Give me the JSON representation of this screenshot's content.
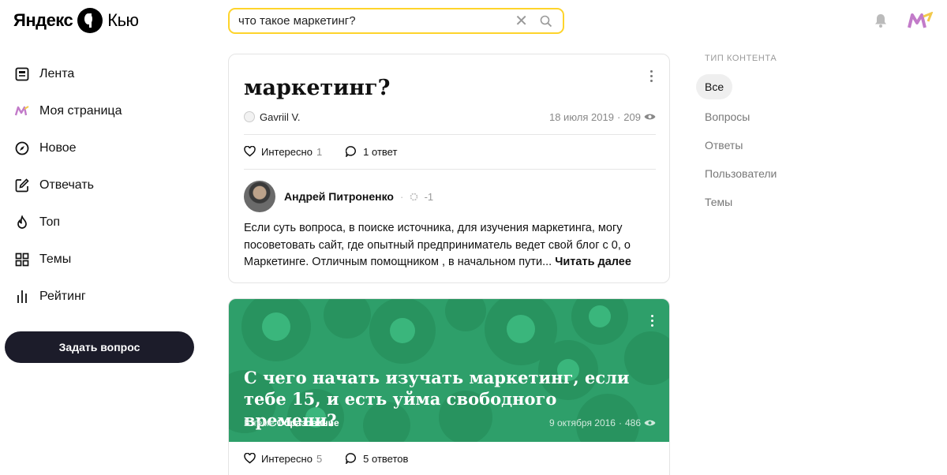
{
  "header": {
    "logo_part1": "Яндекс",
    "logo_part2": "Кью",
    "search_value": "что такое маркетинг?"
  },
  "sidebar": {
    "items": [
      {
        "label": "Лента",
        "icon": "feed-icon"
      },
      {
        "label": "Моя страница",
        "icon": "my-page-icon"
      },
      {
        "label": "Новое",
        "icon": "compass-icon"
      },
      {
        "label": "Отвечать",
        "icon": "edit-icon"
      },
      {
        "label": "Топ",
        "icon": "fire-icon"
      },
      {
        "label": "Темы",
        "icon": "grid-icon"
      },
      {
        "label": "Рейтинг",
        "icon": "bars-icon"
      }
    ],
    "ask_button": "Задать вопрос"
  },
  "feed": {
    "card1": {
      "title": "маркетинг?",
      "author": "Gavriil V.",
      "date": "18 июля 2019",
      "separator": "·",
      "views": "209",
      "like_label": "Интересно",
      "like_count": "1",
      "comments_label": "1 ответ",
      "answer_author": "Андрей Питроненко",
      "answer_score": "-1",
      "answer_text": "Если суть вопроса, в поиске источника, для изучения маркетинга, могу посоветовать сайт, где опытный предприниматель ведет свой блог с 0, о Маркетинге. Отличным помощником , в начальном пути...",
      "read_more": "Читать далее"
    },
    "card2": {
      "title": "С чего начать изучать маркетинг, если тебе 15, и есть уйма свободного времени?",
      "theme_prefix": "В теме",
      "theme_name": "Образование",
      "date": "9 октября 2016",
      "separator": "·",
      "views": "486",
      "like_label": "Интересно",
      "like_count": "5",
      "comments_label": "5 ответов",
      "banner_color": "#2e9f6a"
    }
  },
  "filter": {
    "header": "ТИП КОНТЕНТА",
    "options": [
      "Все",
      "Вопросы",
      "Ответы",
      "Пользователи",
      "Темы"
    ],
    "active": "Все"
  },
  "colors": {
    "search_border": "#fed42b",
    "ask_button_bg": "#1c1c2a"
  }
}
